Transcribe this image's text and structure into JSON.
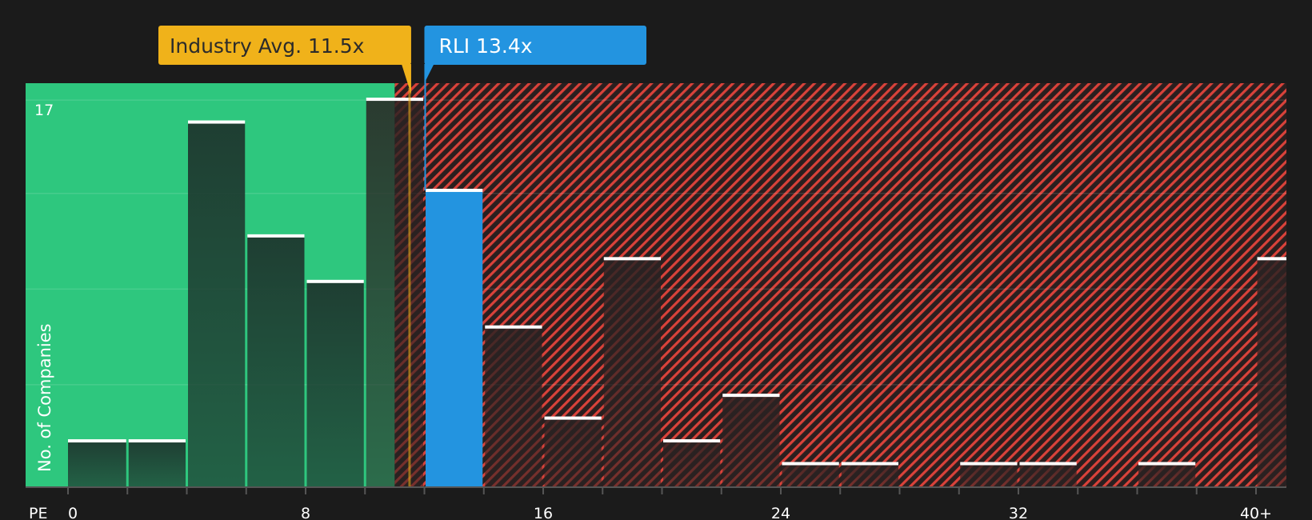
{
  "chart_data": {
    "type": "bar",
    "xlabel": "PE",
    "ylabel": "No. of Companies",
    "ylim": [
      0,
      17.6
    ],
    "y_ticks": [
      17
    ],
    "x_ticks": [
      "0",
      "8",
      "16",
      "24",
      "32",
      "40+"
    ],
    "x_tick_values": [
      0,
      8,
      16,
      24,
      32,
      40
    ],
    "bin_width": 2,
    "bins": [
      {
        "start": 0,
        "value": 2
      },
      {
        "start": 2,
        "value": 2
      },
      {
        "start": 4,
        "value": 16
      },
      {
        "start": 6,
        "value": 11
      },
      {
        "start": 8,
        "value": 9
      },
      {
        "start": 10,
        "value": 17
      },
      {
        "start": 12,
        "value": 13
      },
      {
        "start": 14,
        "value": 7
      },
      {
        "start": 16,
        "value": 3
      },
      {
        "start": 18,
        "value": 10
      },
      {
        "start": 20,
        "value": 2
      },
      {
        "start": 22,
        "value": 4
      },
      {
        "start": 24,
        "value": 1
      },
      {
        "start": 26,
        "value": 1
      },
      {
        "start": 28,
        "value": 0
      },
      {
        "start": 30,
        "value": 1
      },
      {
        "start": 32,
        "value": 1
      },
      {
        "start": 34,
        "value": 0
      },
      {
        "start": 36,
        "value": 1
      },
      {
        "start": 38,
        "value": 0
      },
      {
        "start": 40,
        "value": 10
      }
    ],
    "fair_zone_end": 11,
    "industry_avg": {
      "label": "Industry Avg. 11.5x",
      "value": 11.5
    },
    "company": {
      "label": "RLI 13.4x",
      "value": 13.4,
      "bin_start": 12
    },
    "grid": true,
    "colors": {
      "background": "#1b1b1b",
      "fair_zone": "#2ec77e",
      "overvalued_zone": "#c0392b",
      "industry_avg": "#f0b21a",
      "company": "#2394e0",
      "bar_cap": "#ffffff"
    }
  }
}
